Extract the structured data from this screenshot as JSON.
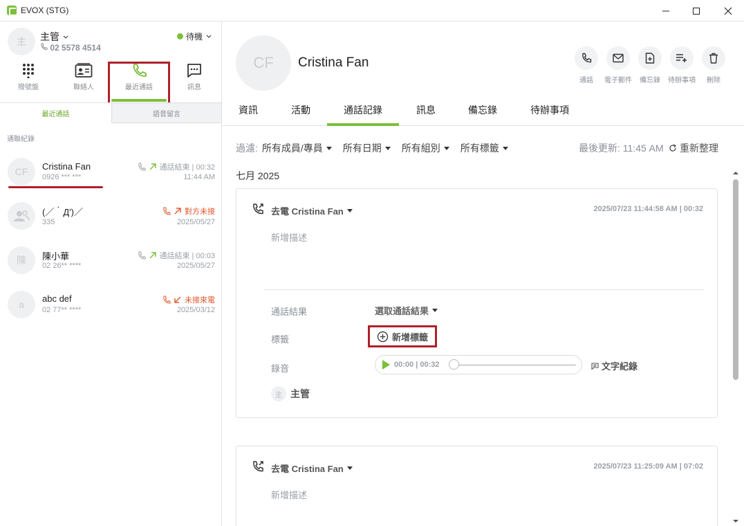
{
  "window": {
    "title": "EVOX (STG)"
  },
  "user": {
    "avatar": "主",
    "name": "主管",
    "phone": "02 5578 4514",
    "status": "待機",
    "status_color": "#7cbf3a"
  },
  "nav": [
    {
      "icon": "dialpad-icon",
      "label": "撥號盤"
    },
    {
      "icon": "contacts-icon",
      "label": "聯絡人"
    },
    {
      "icon": "phone-icon",
      "label": "最近通話",
      "active": true
    },
    {
      "icon": "message-icon",
      "label": "訊息"
    }
  ],
  "subtabs": {
    "recent": "最近通話",
    "voicemail": "語音留言"
  },
  "section_label": "通聯紀錄",
  "calls": [
    {
      "avatar": "CF",
      "name": "Cristina Fan",
      "number": "0926 *** ***",
      "status": "通話結束 | 00:32",
      "time": "11:44 AM",
      "type": "outgoing"
    },
    {
      "avatar": "",
      "name": "(／｀Д')／",
      "number": "335",
      "status": "對方未接",
      "time": "2025/05/27",
      "type": "missed-outgoing"
    },
    {
      "avatar": "陳",
      "name": "陳小華",
      "number": "02 26** ****",
      "status": "通話結束 | 00:03",
      "time": "2025/05/27",
      "type": "outgoing"
    },
    {
      "avatar": "a",
      "name": "abc def",
      "number": "02 77** ****",
      "status": "未接來電",
      "time": "2025/03/12",
      "type": "missed-incoming"
    }
  ],
  "contact": {
    "avatar": "CF",
    "name": "Cristina Fan",
    "actions": [
      {
        "icon": "phone-icon",
        "label": "通話"
      },
      {
        "icon": "mail-icon",
        "label": "電子郵件"
      },
      {
        "icon": "note-add-icon",
        "label": "備忘錄"
      },
      {
        "icon": "todo-add-icon",
        "label": "待辦事項"
      },
      {
        "icon": "trash-icon",
        "label": "刪除"
      }
    ]
  },
  "tabs": [
    "資訊",
    "活動",
    "通話記錄",
    "訊息",
    "備忘錄",
    "待辦事項"
  ],
  "filters": {
    "label": "過濾:",
    "members": "所有成員/專員",
    "dates": "所有日期",
    "groups": "所有組別",
    "tags": "所有標籤",
    "last_updated": "最後更新: 11:45 AM",
    "refresh": "重新整理"
  },
  "month": "七月 2025",
  "records": [
    {
      "title": "去電 Cristina Fan",
      "timestamp": "2025/07/23 11:44:58 AM | 00:32",
      "description_placeholder": "新增描述",
      "result_label": "通話結果",
      "result_value": "選取通話結果",
      "tag_label": "標籤",
      "add_tag": "新增標籤",
      "recording_label": "錄音",
      "recording_time": "00:00 | 00:32",
      "recording_progress": 0,
      "transcript": "文字紀錄",
      "owner_avatar": "主",
      "owner": "主管"
    },
    {
      "title": "去電 Cristina Fan",
      "timestamp": "2025/07/23 11:25:09 AM | 07:02",
      "description_placeholder": "新增描述"
    }
  ],
  "colors": {
    "accent": "#7cbf3a",
    "missed": "#e0562a",
    "highlight": "#b0202a"
  }
}
